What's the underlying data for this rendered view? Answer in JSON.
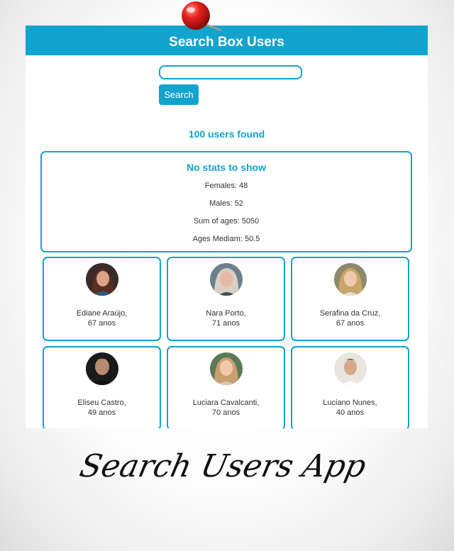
{
  "header": {
    "title": "Search Box Users"
  },
  "search": {
    "value": "",
    "button_label": "Search"
  },
  "results": {
    "count_text": "100 users found"
  },
  "stats": {
    "title": "No stats to show",
    "females": "Females: 48",
    "males": "Males: 52",
    "sum_ages": "Sum of ages: 5050",
    "median": "Ages Mediam: 50.5"
  },
  "users": [
    {
      "name": "Ediane Araújo,",
      "age": "67 anos"
    },
    {
      "name": "Nara Porto,",
      "age": "71 anos"
    },
    {
      "name": "Serafina da Cruz,",
      "age": "67 anos"
    },
    {
      "name": "Eliseu Castro,",
      "age": "49 anos"
    },
    {
      "name": "Luciara Cavalcanti,",
      "age": "70 anos"
    },
    {
      "name": "Luciano Nunes,",
      "age": "40 anos"
    }
  ],
  "caption": "Search Users App",
  "colors": {
    "accent": "#12a4cc",
    "pin": "#e0161b"
  }
}
